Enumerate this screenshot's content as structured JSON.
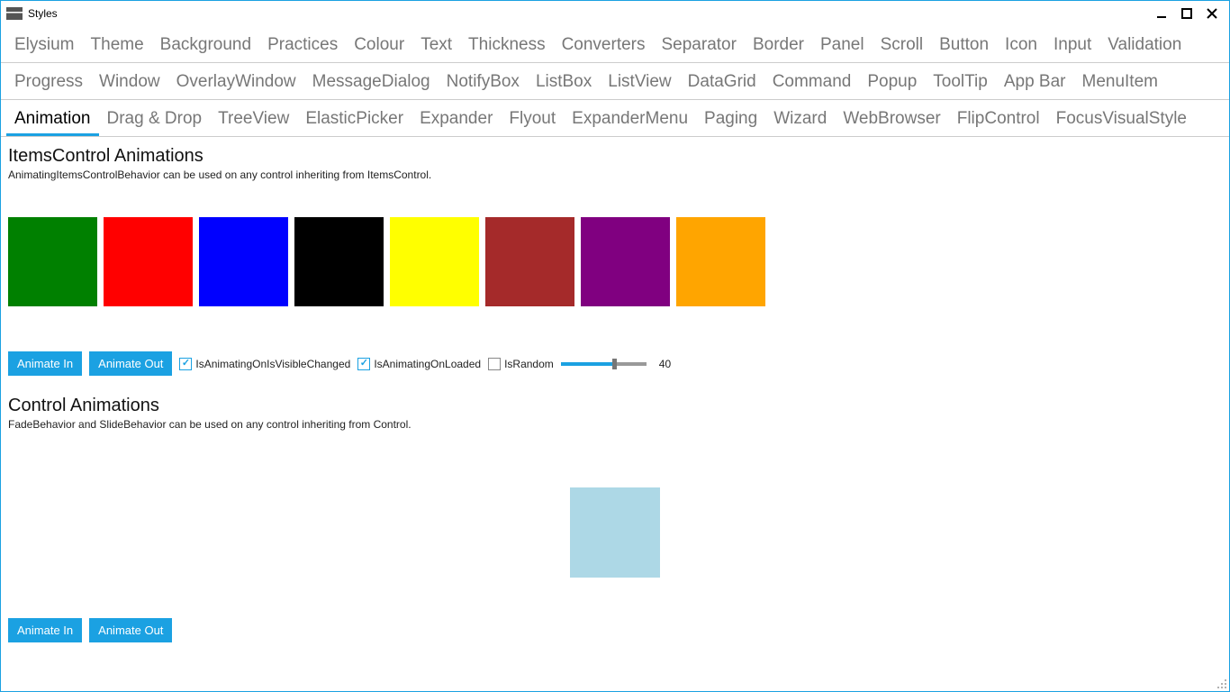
{
  "window": {
    "title": "Styles"
  },
  "tabs": {
    "row1": [
      "Elysium",
      "Theme",
      "Background",
      "Practices",
      "Colour",
      "Text",
      "Thickness",
      "Converters",
      "Separator",
      "Border",
      "Panel",
      "Scroll",
      "Button",
      "Icon",
      "Input",
      "Validation"
    ],
    "row2": [
      "Progress",
      "Window",
      "OverlayWindow",
      "MessageDialog",
      "NotifyBox",
      "ListBox",
      "ListView",
      "DataGrid",
      "Command",
      "Popup",
      "ToolTip",
      "App Bar",
      "MenuItem"
    ],
    "row3": [
      "Animation",
      "Drag & Drop",
      "TreeView",
      "ElasticPicker",
      "Expander",
      "Flyout",
      "ExpanderMenu",
      "Paging",
      "Wizard",
      "WebBrowser",
      "FlipControl",
      "FocusVisualStyle"
    ],
    "selected": "Animation"
  },
  "itemsControl": {
    "title": "ItemsControl Animations",
    "desc": "AnimatingItemsControlBehavior can be used on any control inheriting from ItemsControl.",
    "swatches": [
      "#008000",
      "#ff0000",
      "#0000ff",
      "#000000",
      "#ffff00",
      "#a52a2a",
      "#800080",
      "#ffa500"
    ],
    "buttons": {
      "in": "Animate In",
      "out": "Animate Out"
    },
    "checks": {
      "visible": {
        "label": "IsAnimatingOnIsVisibleChanged",
        "checked": true
      },
      "loaded": {
        "label": "IsAnimatingOnLoaded",
        "checked": true
      },
      "random": {
        "label": "IsRandom",
        "checked": false
      }
    },
    "slider": {
      "value": 40
    }
  },
  "control": {
    "title": "Control Animations",
    "desc": "FadeBehavior and SlideBehavior can be used on any control inheriting from Control.",
    "swatch": "#add8e6",
    "buttons": {
      "in": "Animate In",
      "out": "Animate Out"
    }
  }
}
